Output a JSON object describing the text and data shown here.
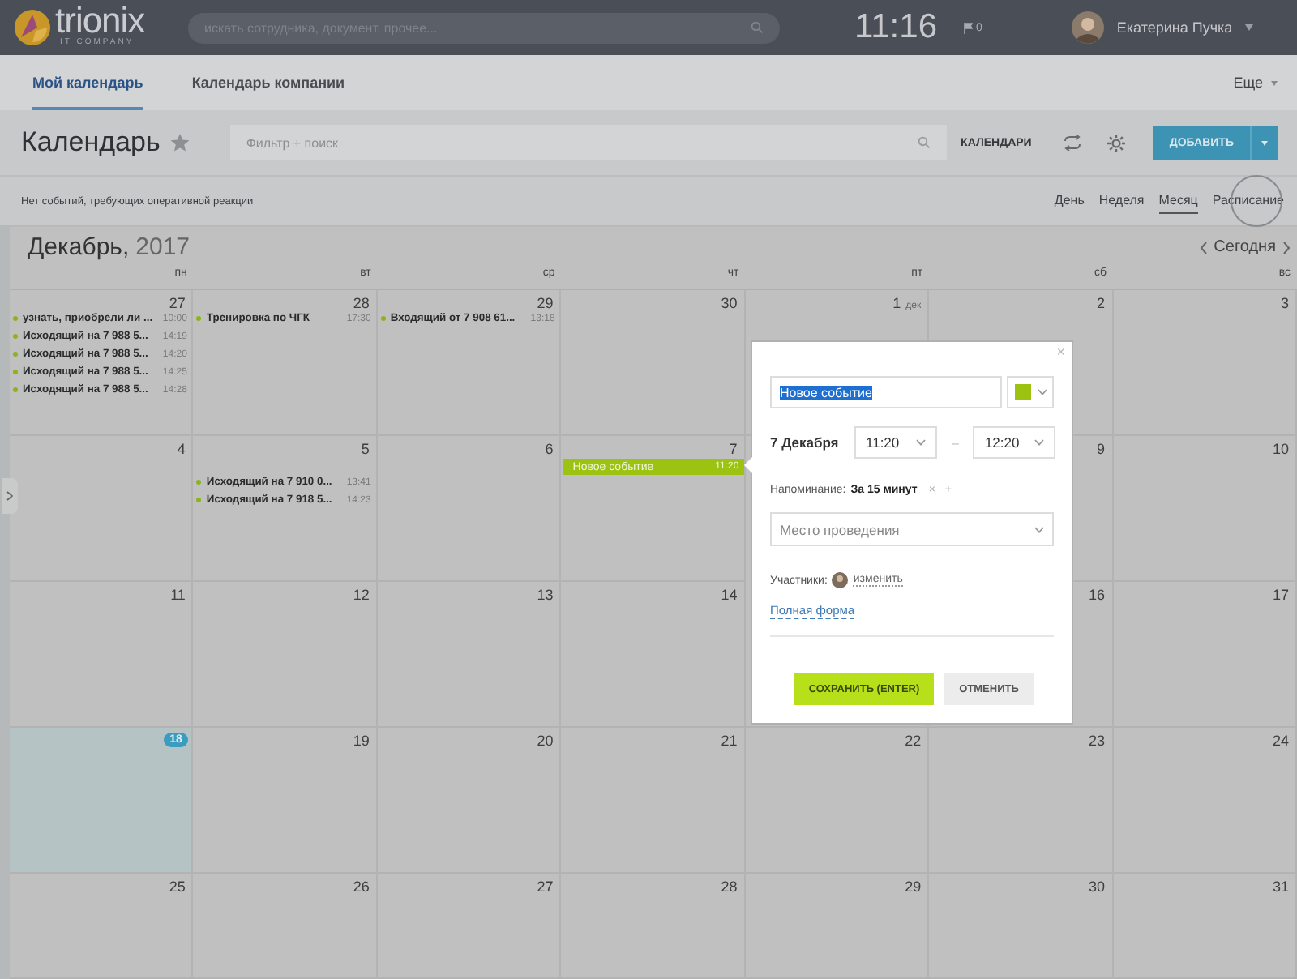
{
  "header": {
    "logo": {
      "name": "trionix",
      "subtitle": "IT COMPANY"
    },
    "search": {
      "placeholder": "искать сотрудника, документ, прочее..."
    },
    "clock": "11:16",
    "flags": "0",
    "user": "Екатерина Пучка"
  },
  "tabs": [
    {
      "label": "Мой календарь",
      "selected": true
    },
    {
      "label": "Календарь компании",
      "selected": false
    }
  ],
  "more": "Еще",
  "toolbar": {
    "title": "Календарь",
    "filter": {
      "placeholder": "Фильтр + поиск"
    },
    "calendars": "КАЛЕНДАРИ",
    "add": "ДОБАВИТЬ"
  },
  "notice": "Нет событий, требующих оперативной реакции",
  "views": [
    {
      "label": "День",
      "selected": false
    },
    {
      "label": "Неделя",
      "selected": false
    },
    {
      "label": "Месяц",
      "selected": true
    },
    {
      "label": "Расписание",
      "selected": false
    }
  ],
  "month": {
    "name": "Декабрь,",
    "year": "2017",
    "today": "Сегодня"
  },
  "weekdays": [
    "пн",
    "вт",
    "ср",
    "чт",
    "пт",
    "сб",
    "вс"
  ],
  "weeks": [
    [
      {
        "number": "27",
        "today": false,
        "events": [
          {
            "kind": "dot",
            "title": "узнать, приобрели ли ...",
            "time": "10:00",
            "color": "#8ab41a"
          },
          {
            "kind": "dot",
            "title": "Исходящий на 7 988 5...",
            "time": "14:19",
            "color": "#8ab41a"
          },
          {
            "kind": "dot",
            "title": "Исходящий на 7 988 5...",
            "time": "14:20",
            "color": "#8ab41a"
          },
          {
            "kind": "dot",
            "title": "Исходящий на 7 988 5...",
            "time": "14:25",
            "color": "#8ab41a"
          },
          {
            "kind": "dot",
            "title": "Исходящий на 7 988 5...",
            "time": "14:28",
            "color": "#8ab41a"
          }
        ]
      },
      {
        "number": "28",
        "today": false,
        "events": [
          {
            "kind": "dot",
            "title": "Тренировка по ЧГК",
            "time": "17:30",
            "color": "#8ab41a"
          }
        ]
      },
      {
        "number": "29",
        "today": false,
        "events": [
          {
            "kind": "dot",
            "title": "Входящий от 7 908 61...",
            "time": "13:18",
            "color": "#8ab41a"
          }
        ]
      },
      {
        "number": "30",
        "today": false
      },
      {
        "number": "1",
        "month": "дек",
        "today": false
      },
      {
        "number": "2",
        "today": false
      },
      {
        "number": "3",
        "today": false
      }
    ],
    [
      {
        "number": "4",
        "today": false
      },
      {
        "number": "5",
        "today": false,
        "events": [
          {
            "kind": "dot",
            "title": "Исходящий на 7 910 0...",
            "time": "13:41",
            "color": "#8ab41a"
          },
          {
            "kind": "dot",
            "title": "Исходящий на 7 918 5...",
            "time": "14:23",
            "color": "#8ab41a"
          }
        ]
      },
      {
        "number": "6",
        "today": false
      },
      {
        "number": "7",
        "today": false,
        "events": [
          {
            "kind": "bar",
            "title": "Новое событие",
            "time": "11:20",
            "color": "#9cc311"
          }
        ]
      },
      {
        "number": "9",
        "today": false
      },
      {
        "number": "10",
        "today": false
      }
    ],
    [
      {
        "number": "11",
        "today": false
      },
      {
        "number": "12",
        "today": false
      },
      {
        "number": "13",
        "today": false
      },
      {
        "number": "14",
        "today": false
      },
      {
        "number": "16",
        "today": false
      },
      {
        "number": "17",
        "today": false
      }
    ],
    [
      {
        "number": "18",
        "today": true
      },
      {
        "number": "19",
        "today": false
      },
      {
        "number": "20",
        "today": false
      },
      {
        "number": "21",
        "today": false
      },
      {
        "number": "22",
        "today": false
      },
      {
        "number": "23",
        "today": false
      },
      {
        "number": "24",
        "today": false
      }
    ],
    [
      {
        "number": "25",
        "today": false
      },
      {
        "number": "26",
        "today": false
      },
      {
        "number": "27",
        "today": false
      },
      {
        "number": "28",
        "today": false
      },
      {
        "number": "29",
        "today": false
      },
      {
        "number": "30",
        "today": false
      },
      {
        "number": "31",
        "today": false
      }
    ]
  ],
  "popup": {
    "close": "×",
    "title": {
      "value": "Новое событие",
      "text_selected": true
    },
    "color": "#9cc311",
    "date": "7 Декабря",
    "start": "11:20",
    "dash": "–",
    "end": "12:20",
    "reminder_label": "Напоминание:",
    "reminder": "За 15 минут",
    "reminder_remove": "×",
    "reminder_add": "+",
    "location": {
      "placeholder": "Место проведения"
    },
    "participants_label": "Участники:",
    "participants_change": "изменить",
    "full_form": "Полная форма",
    "save": "СОХРАНИТЬ (ENTER)",
    "cancel": "ОТМЕНИТЬ"
  }
}
